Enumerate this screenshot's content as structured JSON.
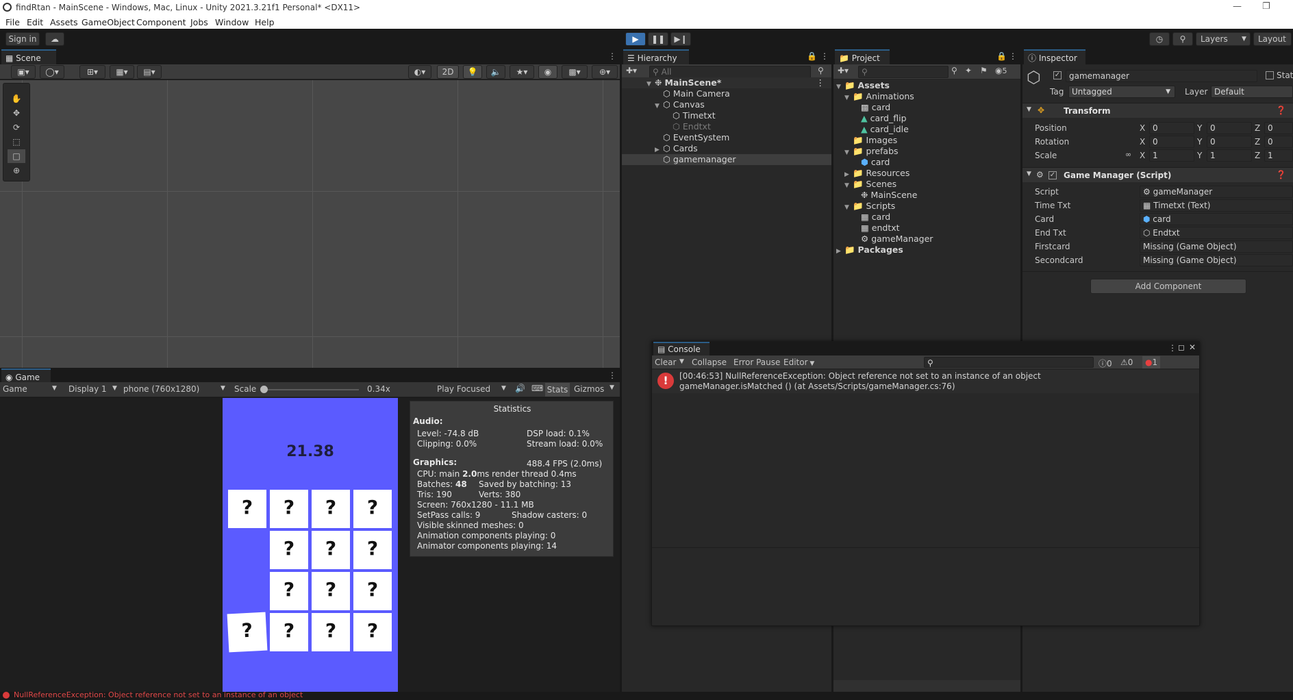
{
  "window": {
    "title": "findRtan - MainScene - Windows, Mac, Linux - Unity 2021.3.21f1 Personal* <DX11>",
    "minimize_icon": "minimize-icon",
    "restore_icon": "restore-icon"
  },
  "menu": [
    "File",
    "Edit",
    "Assets",
    "GameObject",
    "Component",
    "Jobs",
    "Window",
    "Help"
  ],
  "toolbar": {
    "sign_in": "Sign in",
    "layers": "Layers",
    "layout": "Layout"
  },
  "scene": {
    "tab": "Scene",
    "mode_2d": "2D"
  },
  "game": {
    "tab": "Game",
    "view_select": "Game",
    "display": "Display 1",
    "resolution": "phone (760x1280)",
    "scale_label": "Scale",
    "scale_value": "0.34x",
    "play_mode": "Play Focused",
    "stats_btn": "Stats",
    "gizmos_btn": "Gizmos",
    "timer": "21.38",
    "card_symbol": "?"
  },
  "statistics": {
    "title": "Statistics",
    "audio_header": "Audio:",
    "level": "Level: -74.8 dB",
    "clipping": "Clipping: 0.0%",
    "dsp_load": "DSP load: 0.1%",
    "stream_load": "Stream load: 0.0%",
    "graphics_header": "Graphics:",
    "fps": "488.4 FPS (2.0ms)",
    "cpu_prefix": "CPU: main ",
    "cpu_main": "2.0",
    "cpu_suffix": "ms  render thread 0.4ms",
    "batches_prefix": "Batches: ",
    "batches": "48",
    "saved_batching": "Saved by batching: 13",
    "tris": "Tris: 190",
    "verts": "Verts: 380",
    "screen": "Screen: 760x1280 - 11.1 MB",
    "setpass": "SetPass calls: 9",
    "shadow_casters": "Shadow casters: 0",
    "skinned_meshes": "Visible skinned meshes: 0",
    "animation_components": "Animation components playing: 0",
    "animator_components": "Animator components playing: 14"
  },
  "hierarchy": {
    "tab": "Hierarchy",
    "search_placeholder": "All",
    "scene_name": "MainScene*",
    "items": [
      "Main Camera",
      "Canvas",
      "Timetxt",
      "Endtxt",
      "EventSystem",
      "Cards",
      "gamemanager"
    ]
  },
  "project": {
    "tab": "Project",
    "hidden_count": "5",
    "assets": "Assets",
    "animations": "Animations",
    "anim_card": "card",
    "anim_card_flip": "card_flip",
    "anim_card_idle": "card_idle",
    "images": "Images",
    "prefabs": "prefabs",
    "prefab_card": "card",
    "resources": "Resources",
    "scenes": "Scenes",
    "scene_main": "MainScene",
    "scripts": "Scripts",
    "script_card": "card",
    "script_endtxt": "endtxt",
    "script_gamemanager": "gameManager",
    "packages": "Packages"
  },
  "inspector": {
    "tab": "Inspector",
    "object_name": "gamemanager",
    "static_label": "Stati",
    "tag_label": "Tag",
    "tag_value": "Untagged",
    "layer_label": "Layer",
    "layer_value": "Default",
    "transform_header": "Transform",
    "position_label": "Position",
    "rotation_label": "Rotation",
    "scale_label": "Scale",
    "x": "X",
    "y": "Y",
    "z": "Z",
    "pos": [
      "0",
      "0",
      "0"
    ],
    "rot": [
      "0",
      "0",
      "0"
    ],
    "scl": [
      "1",
      "1",
      "1"
    ],
    "gm_header": "Game Manager (Script)",
    "script_label": "Script",
    "script_value": "gameManager",
    "timetxt_label": "Time Txt",
    "timetxt_value": "Timetxt (Text)",
    "card_label": "Card",
    "card_value": "card",
    "endtxt_label": "End Txt",
    "endtxt_value": "Endtxt",
    "firstcard_label": "Firstcard",
    "firstcard_value": "Missing (Game Object)",
    "secondcard_label": "Secondcard",
    "secondcard_value": "Missing (Game Object)",
    "add_component": "Add Component"
  },
  "console": {
    "tab": "Console",
    "clear": "Clear",
    "collapse": "Collapse",
    "error_pause": "Error Pause",
    "editor": "Editor",
    "info_count": "0",
    "warn_count": "0",
    "error_count": "1",
    "error_line1": "[00:46:53] NullReferenceException: Object reference not set to an instance of an object",
    "error_line2": "gameManager.isMatched () (at Assets/Scripts/gameManager.cs:76)"
  },
  "statusbar": {
    "message": "NullReferenceException: Object reference not set to an instance of an object"
  },
  "colors": {
    "game_background": "#5b5bff",
    "error_red": "#d93a3a",
    "accent_blue": "#2c5d87",
    "selected_row": "#3e3e3e"
  }
}
